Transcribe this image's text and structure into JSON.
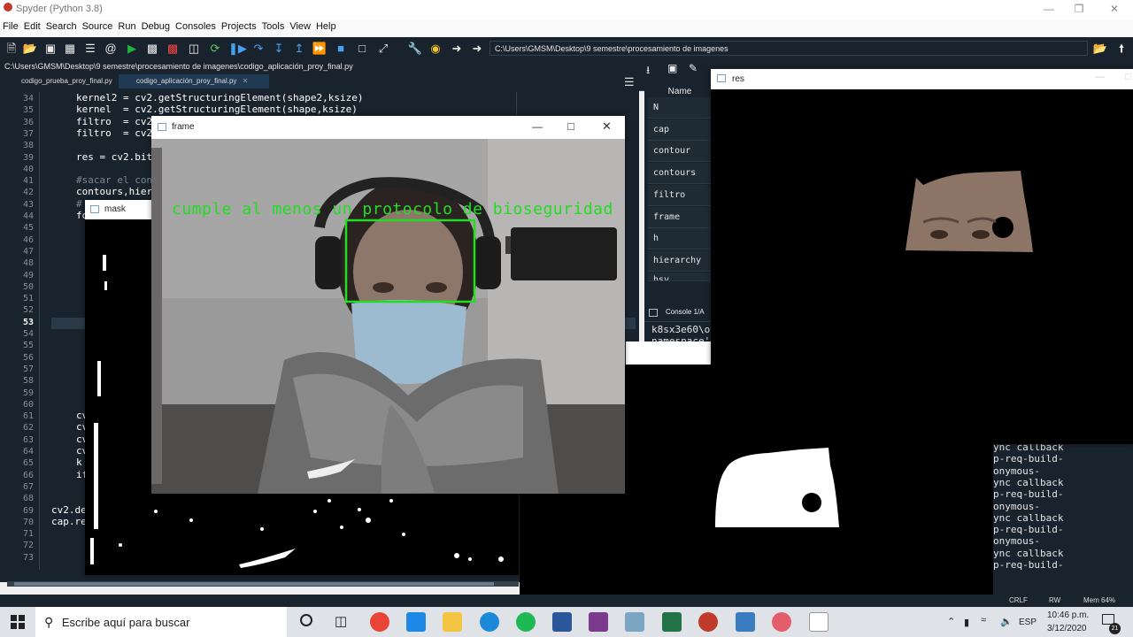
{
  "app": {
    "title": "Spyder (Python 3.8)"
  },
  "menu": [
    "File",
    "Edit",
    "Search",
    "Source",
    "Run",
    "Debug",
    "Consoles",
    "Projects",
    "Tools",
    "View",
    "Help"
  ],
  "toolbar": {
    "working_dir": "C:\\Users\\GMSM\\Desktop\\9 semestre\\procesamiento de imagenes"
  },
  "editor": {
    "file_path": "C:\\Users\\GMSM\\Desktop\\9 semestre\\procesamiento de imagenes\\codigo_aplicación_proy_final.py",
    "tabs": [
      {
        "label": "codigo_prueba_proy_final.py"
      },
      {
        "label": "codigo_aplicación_proy_final.py"
      }
    ],
    "line_numbers": [
      "34",
      "35",
      "36",
      "37",
      "38",
      "39",
      "40",
      "41",
      "42",
      "43",
      "44",
      "45",
      "46",
      "47",
      "48",
      "49",
      "50",
      "51",
      "52",
      "53",
      "54",
      "55",
      "56",
      "57",
      "58",
      "59",
      "60",
      "61",
      "62",
      "63",
      "64",
      "65",
      "66",
      "67",
      "68",
      "69",
      "70",
      "71",
      "72",
      "73"
    ],
    "current_line": "53",
    "visible_code": [
      {
        "line": "34",
        "text": "kernel2 = cv2.getStructuringElement(shape2,ksize)"
      },
      {
        "line": "35",
        "text": "kernel  = cv2.getStructuringElement(shape,ksize)"
      },
      {
        "line": "36",
        "text": "filtro  = cv2"
      },
      {
        "line": "37",
        "text": "filtro  = cv2"
      },
      {
        "line": "39",
        "text": "res = cv2.bit"
      },
      {
        "line": "41",
        "text": "#sacar el con"
      },
      {
        "line": "42",
        "text": "contours,hier"
      },
      {
        "line": "43",
        "text": "#"
      },
      {
        "line": "44",
        "text": "fo"
      },
      {
        "line": "61",
        "text": "cv"
      },
      {
        "line": "62",
        "text": "cv"
      },
      {
        "line": "63",
        "text": "cv"
      },
      {
        "line": "64",
        "text": "cv"
      },
      {
        "line": "65",
        "text": "k"
      },
      {
        "line": "66",
        "text": "if"
      },
      {
        "line": "69",
        "text": "cv2.de"
      },
      {
        "line": "70",
        "text": "cap.re"
      }
    ]
  },
  "variables": {
    "header": "Name",
    "names": [
      "N",
      "cap",
      "contour",
      "contours",
      "filtro",
      "frame",
      "h",
      "hierarchy",
      "hsv"
    ]
  },
  "console": {
    "tab": "Console 1/A",
    "top_lines": [
      "k8sx3e60\\o",
      "namespace'"
    ],
    "bottom_lines": [
      "ync callback",
      "p-req-build-",
      "onymous-",
      "ync callback",
      "p-req-build-",
      "onymous-",
      "ync callback",
      "p-req-build-",
      "onymous-",
      "ync callback",
      "p-req-build-"
    ]
  },
  "windows": {
    "frame": {
      "title": "frame",
      "overlay_text": "cumple al menos un protocolo de bioseguridad"
    },
    "mask": {
      "title": "mask"
    },
    "res": {
      "title": "res"
    }
  },
  "statusbar": {
    "eol": "CRLF",
    "rw": "RW",
    "mem": "Mem 64%"
  },
  "taskbar": {
    "search_placeholder": "Escribe aquí para buscar",
    "lang": "ESP",
    "time": "10:46 p.m.",
    "date": "3/12/2020",
    "notif_count": "21"
  },
  "colors": {
    "spyder_bg": "#19232d",
    "overlay_green": "#22dd22"
  }
}
